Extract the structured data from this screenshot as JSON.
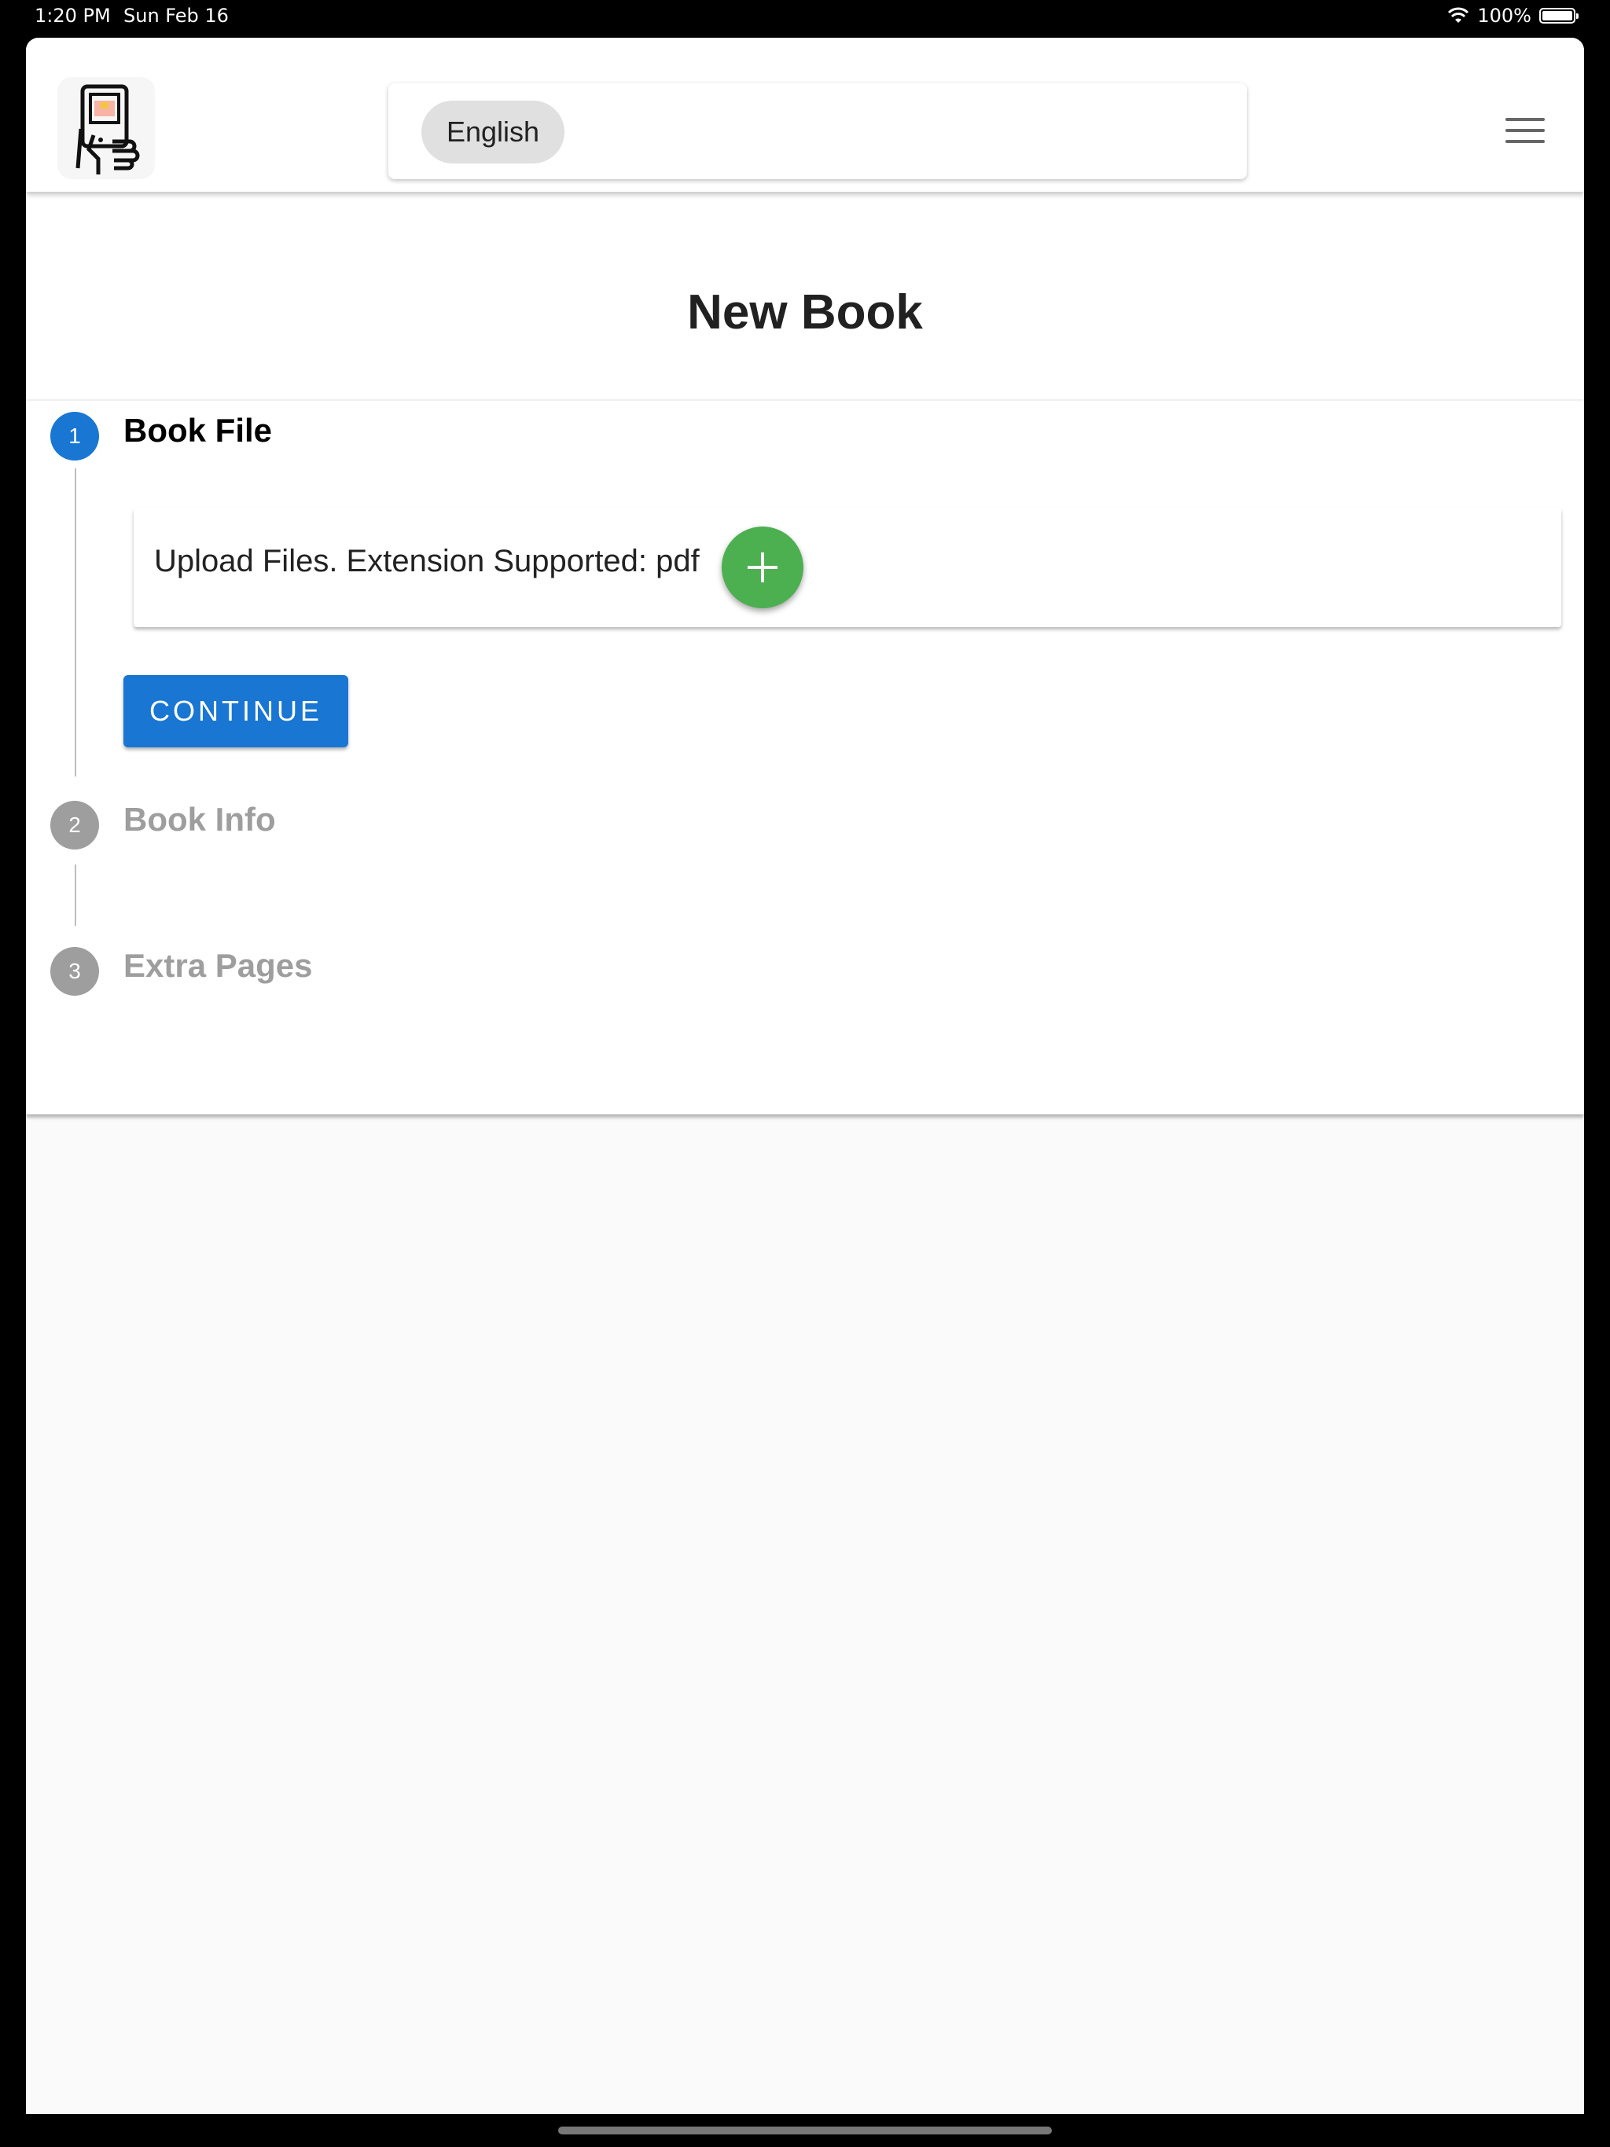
{
  "status_bar": {
    "time": "1:20 PM",
    "date": "Sun Feb 16",
    "battery": "100%"
  },
  "header": {
    "language_chip": "English",
    "logo_icon": "ereader-hand-icon",
    "menu_icon": "hamburger-menu-icon"
  },
  "page": {
    "title": "New Book"
  },
  "stepper": {
    "active_color": "#1976d2",
    "inactive_color": "#9e9e9e",
    "steps": [
      {
        "number": "1",
        "label": "Book File",
        "state": "active"
      },
      {
        "number": "2",
        "label": "Book Info",
        "state": "inactive"
      },
      {
        "number": "3",
        "label": "Extra Pages",
        "state": "inactive"
      }
    ]
  },
  "upload": {
    "text": "Upload Files. Extension Supported: pdf",
    "add_button_icon": "plus-icon",
    "add_button_color": "#4caf50"
  },
  "actions": {
    "continue_label": "CONTINUE"
  }
}
